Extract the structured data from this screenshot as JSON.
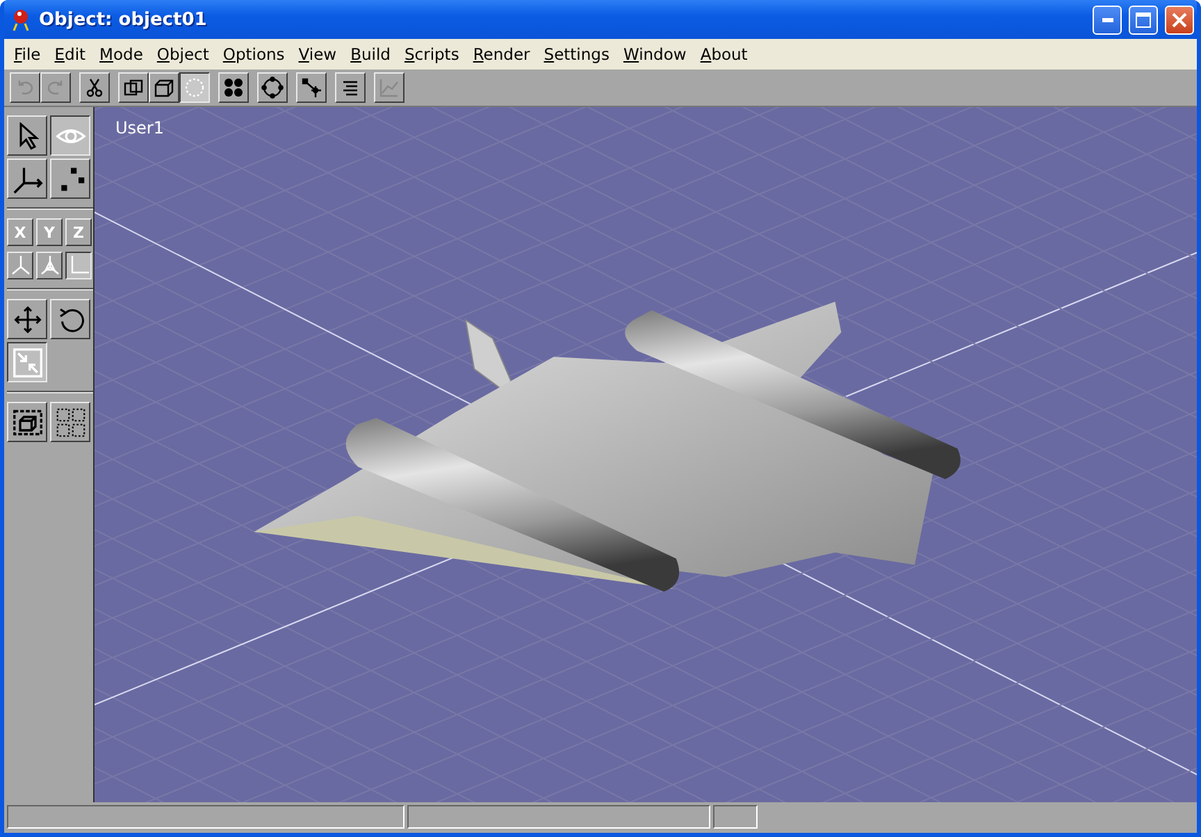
{
  "window": {
    "title": "Object: object01"
  },
  "menu": [
    "File",
    "Edit",
    "Mode",
    "Object",
    "Options",
    "View",
    "Build",
    "Scripts",
    "Render",
    "Settings",
    "Window",
    "About"
  ],
  "toolbar": [
    [
      {
        "selected": false,
        "disabled": true
      },
      {
        "selected": false,
        "disabled": true
      }
    ],
    [
      {
        "selected": false,
        "disabled": false
      }
    ],
    [
      {
        "selected": false,
        "disabled": false
      },
      {
        "selected": false,
        "disabled": false
      },
      {
        "selected": true,
        "disabled": false
      }
    ],
    [
      {
        "selected": false,
        "disabled": false
      }
    ],
    [
      {
        "selected": false,
        "disabled": false
      }
    ],
    [
      {
        "selected": false,
        "disabled": false
      }
    ],
    [
      {
        "selected": false,
        "disabled": false
      }
    ],
    [
      {
        "selected": false,
        "disabled": true
      }
    ]
  ],
  "toolbox": {
    "tools": [
      {
        "selected": false
      },
      {
        "selected": true
      },
      {
        "selected": false
      },
      {
        "selected": false
      }
    ],
    "axes": [
      {
        "label": "X",
        "selected": false
      },
      {
        "label": "Y",
        "selected": false
      },
      {
        "label": "Z",
        "selected": false
      }
    ],
    "orientations": [
      {
        "selected": false
      },
      {
        "selected": false
      },
      {
        "selected": true
      }
    ],
    "transforms": [
      {
        "selected": false
      },
      {
        "selected": false
      },
      {
        "selected": true
      }
    ],
    "selections": [
      {
        "selected": false
      },
      {
        "selected": false
      }
    ]
  },
  "viewport": {
    "label": "User1"
  }
}
